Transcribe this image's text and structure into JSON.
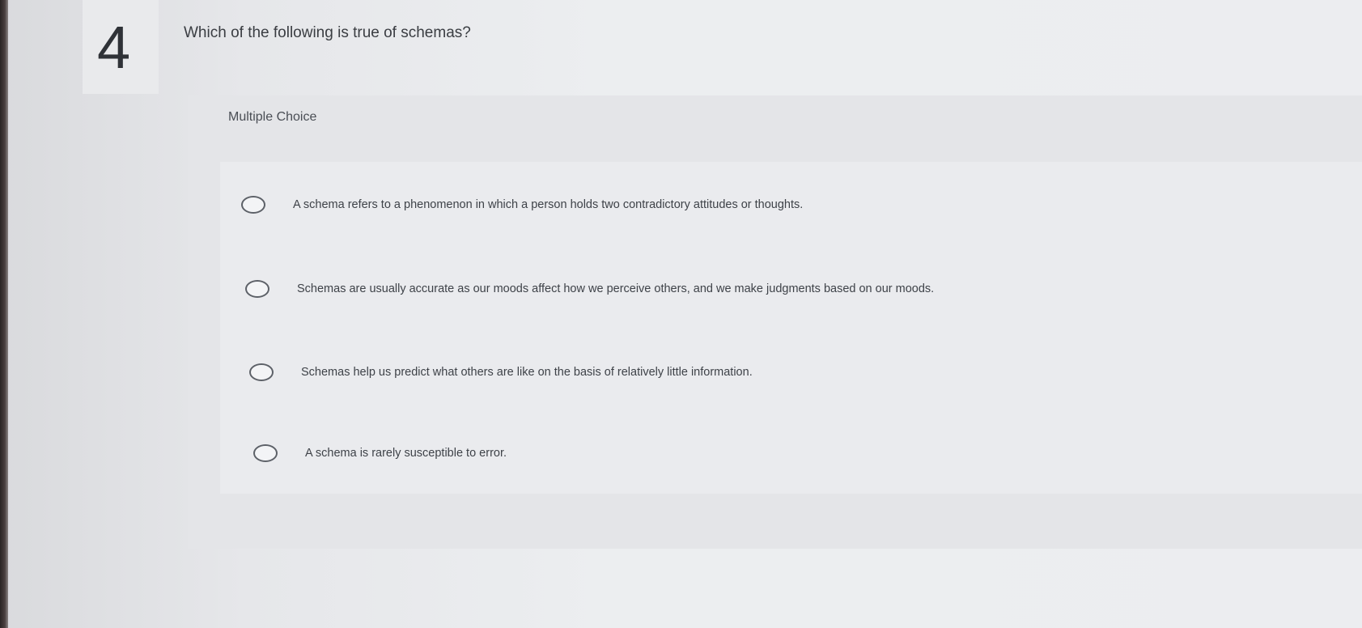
{
  "question": {
    "number": "4",
    "prompt": "Which of the following is true of schemas?",
    "type_label": "Multiple Choice",
    "options": [
      {
        "label": "A schema refers to a phenomenon in which a person holds two contradictory attitudes or thoughts."
      },
      {
        "label": "Schemas are usually accurate as our moods affect how we perceive others, and we make judgments based on our moods."
      },
      {
        "label": "Schemas help us predict what others are like on the basis of relatively little information."
      },
      {
        "label": "A schema is rarely susceptible to error."
      }
    ]
  }
}
